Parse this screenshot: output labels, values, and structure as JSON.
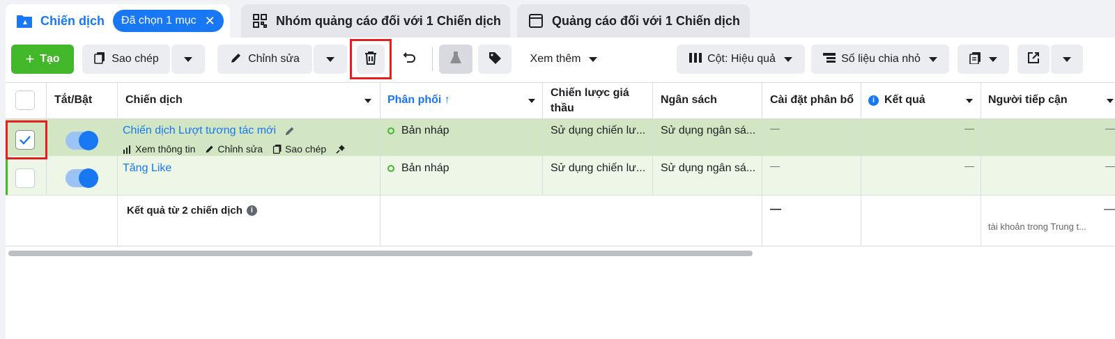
{
  "tabs": {
    "campaigns": {
      "label": "Chiến dịch",
      "selected_pill": "Đã chọn 1 mục"
    },
    "adsets": {
      "label": "Nhóm quảng cáo đối với 1 Chiến dịch"
    },
    "ads": {
      "label": "Quảng cáo đối với 1 Chiến dịch"
    }
  },
  "toolbar": {
    "create_label": "Tạo",
    "copy_label": "Sao chép",
    "edit_label": "Chỉnh sửa",
    "more_label": "Xem thêm",
    "columns_label": "Cột: Hiệu quả",
    "breakdown_label": "Số liệu chia nhỏ"
  },
  "table": {
    "headers": {
      "toggle": "Tắt/Bật",
      "campaign": "Chiến dịch",
      "delivery": "Phân phối ↑",
      "bid_strategy_1": "Chiến lược giá",
      "bid_strategy_2": "thầu",
      "budget": "Ngân sách",
      "attribution": "Cài đặt phân bổ",
      "results": "Kết quả",
      "reach": "Người tiếp cận"
    },
    "rows": [
      {
        "name": "Chiến dịch Lượt tương tác mới",
        "delivery": "Bản nháp",
        "bid_strategy": "Sử dụng chiến lư...",
        "budget": "Sử dụng ngân sá...",
        "attribution": "—",
        "results": "—",
        "reach": "—",
        "checked": true,
        "actions": {
          "view": "Xem thông tin",
          "edit": "Chỉnh sửa",
          "copy": "Sao chép"
        }
      },
      {
        "name": "Tăng Like",
        "delivery": "Bản nháp",
        "bid_strategy": "Sử dụng chiến lư...",
        "budget": "Sử dụng ngân sá...",
        "attribution": "—",
        "results": "—",
        "reach": "—",
        "checked": false
      }
    ],
    "summary": {
      "label": "Kết quả từ 2 chiến dịch",
      "attribution": "—",
      "reach": "—",
      "reach_note": "tài khoản trong Trung t..."
    }
  },
  "colors": {
    "accent": "#1877f2",
    "create": "#42b72a",
    "selected_row": "#d2e6c3",
    "highlight": "#e41e1e"
  }
}
